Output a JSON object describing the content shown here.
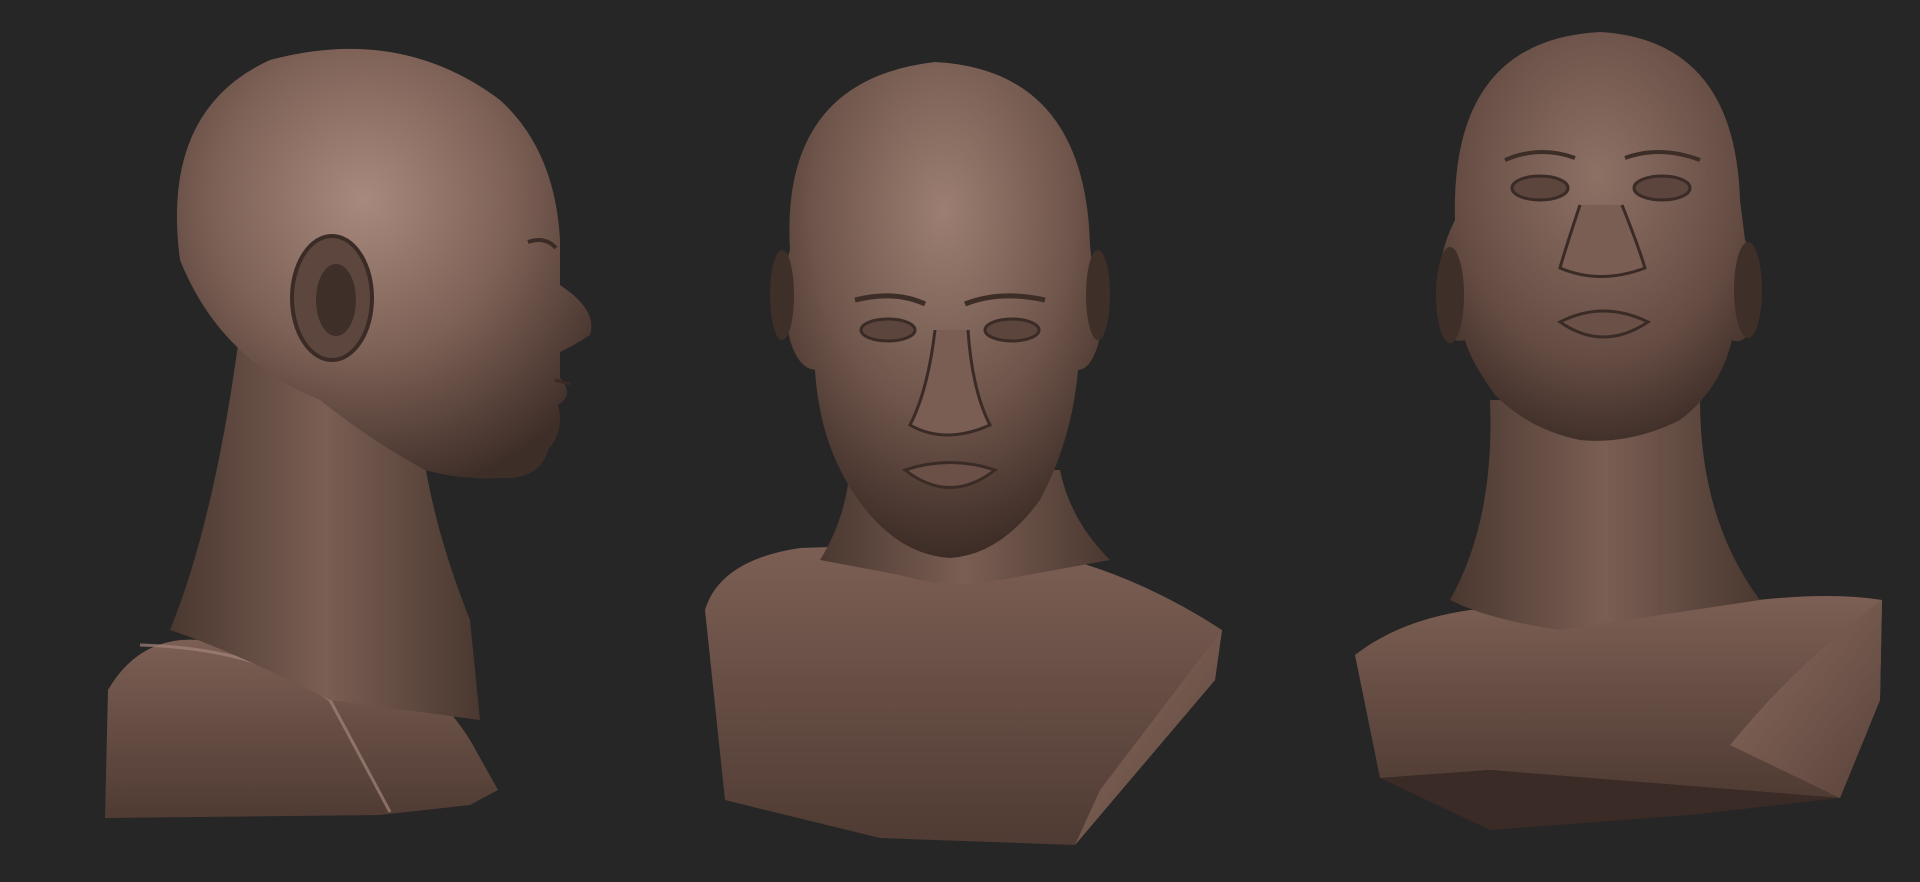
{
  "scene": {
    "background_color": "#262626",
    "clay_color": "#6e544a",
    "clay_highlight": "#a88a7d",
    "clay_shadow": "#3a2b26",
    "views": [
      {
        "name": "side-view",
        "pose": "profile-right"
      },
      {
        "name": "front-view",
        "pose": "front-tilted-down"
      },
      {
        "name": "low-angle-view",
        "pose": "front-tilted-up"
      }
    ]
  }
}
